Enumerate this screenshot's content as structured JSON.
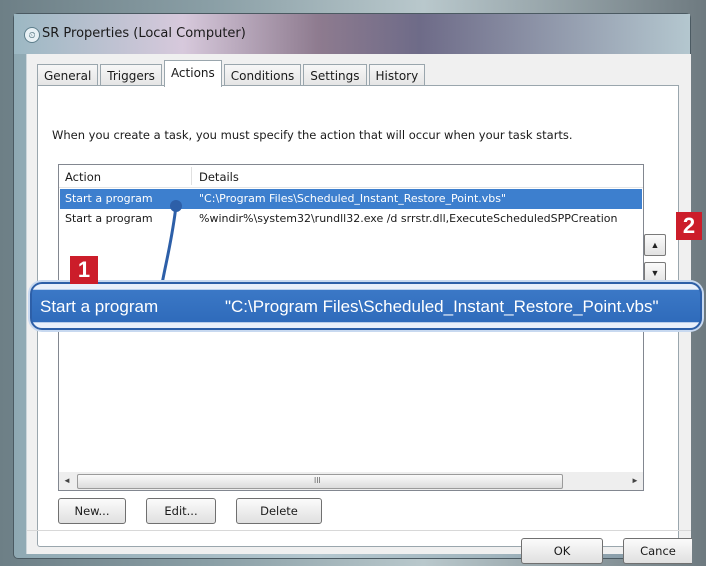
{
  "window": {
    "title": "SR Properties (Local Computer)"
  },
  "tabs": [
    {
      "label": "General",
      "active": false
    },
    {
      "label": "Triggers",
      "active": false
    },
    {
      "label": "Actions",
      "active": true
    },
    {
      "label": "Conditions",
      "active": false
    },
    {
      "label": "Settings",
      "active": false
    },
    {
      "label": "History",
      "active": false
    }
  ],
  "actions": {
    "intro": "When you create a task, you must specify the action that will occur when your task starts.",
    "columns": {
      "action": "Action",
      "details": "Details"
    },
    "rows": [
      {
        "action": "Start a program",
        "details": "\"C:\\Program Files\\Scheduled_Instant_Restore_Point.vbs\"",
        "selected": true
      },
      {
        "action": "Start a program",
        "details": "%windir%\\system32\\rundll32.exe /d srrstr.dll,ExecuteScheduledSPPCreation",
        "selected": false
      }
    ],
    "buttons": {
      "new": "New...",
      "edit": "Edit...",
      "delete": "Delete"
    },
    "move_up_glyph": "▲",
    "move_down_glyph": "▼"
  },
  "scrollbar": {
    "left_glyph": "◄",
    "right_glyph": "►",
    "grip_glyph": "III"
  },
  "footer": {
    "ok": "OK",
    "cancel": "Cance"
  },
  "callout": {
    "action": "Start a program",
    "details": "\"C:\\Program Files\\Scheduled_Instant_Restore_Point.vbs\""
  },
  "markers": {
    "one": "1",
    "two": "2",
    "color": "#cc1d2a"
  },
  "colors": {
    "selection": "#3d7fce",
    "callout_border": "#2d5fa8"
  }
}
